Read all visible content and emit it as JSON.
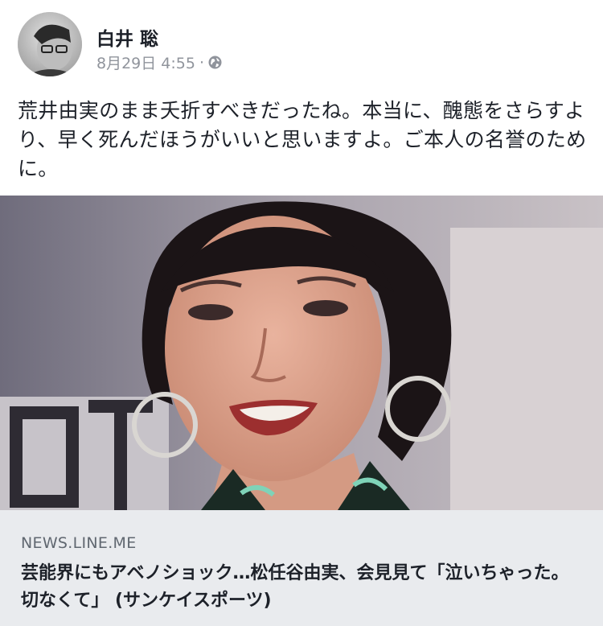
{
  "post": {
    "author": "白井 聡",
    "date": "8月29日 4:55",
    "separator": "·",
    "privacy_icon": "globe-icon",
    "message": "荒井由実のまま夭折すべきだったね。本当に、醜態をさらすより、早く死んだほうがいいと思いますよ。ご本人の名誉のために。"
  },
  "link": {
    "domain": "NEWS.LINE.ME",
    "title": "芸能界にもアベノショック…松任谷由実、会見見て「泣いちゃった。切なくて」 (サンケイスポーツ)"
  },
  "colors": {
    "text": "#1d2129",
    "meta": "#90949c",
    "link_bg": "#e9ebee"
  }
}
